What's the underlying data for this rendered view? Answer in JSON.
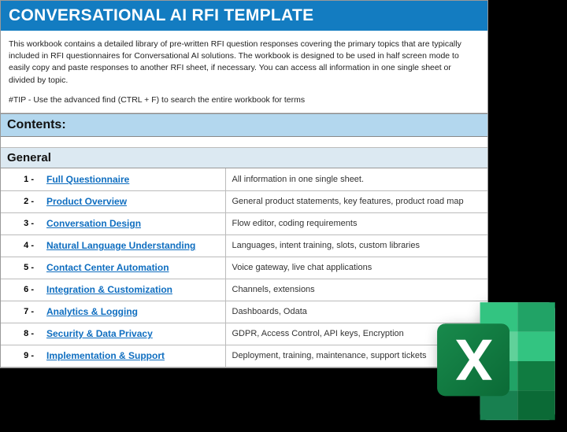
{
  "title": "CONVERSATIONAL AI RFI TEMPLATE",
  "intro": {
    "body": "This workbook contains a detailed library of pre-written RFI question responses covering the primary topics that are typically included in RFI questionnaires for Conversational AI solutions. The workbook is designed to be used in half screen mode to easily copy and paste responses to another RFI sheet, if necessary. You can access all information in one single sheet or divided by topic.",
    "tip": "#TIP - Use the advanced find (CTRL + F) to search the entire workbook for terms"
  },
  "contents_label": "Contents:",
  "section_label": "General",
  "rows": [
    {
      "num": "1 -",
      "link": "Full Questionnaire",
      "desc": "All information in one single sheet."
    },
    {
      "num": "2 -",
      "link": "Product Overview",
      "desc": "General product statements, key features, product road map"
    },
    {
      "num": "3 -",
      "link": "Conversation Design",
      "desc": "Flow editor, coding requirements"
    },
    {
      "num": "4 -",
      "link": "Natural Language Understanding",
      "desc": "Languages, intent training, slots, custom libraries"
    },
    {
      "num": "5 -",
      "link": "Contact Center Automation",
      "desc": "Voice gateway, live chat applications"
    },
    {
      "num": "6 -",
      "link": "Integration & Customization",
      "desc": "Channels, extensions"
    },
    {
      "num": "7 -",
      "link": "Analytics & Logging",
      "desc": "Dashboards, Odata"
    },
    {
      "num": "8 -",
      "link": "Security & Data Privacy",
      "desc": "GDPR, Access Control, API keys, Encryption"
    },
    {
      "num": "9 -",
      "link": "Implementation & Support",
      "desc": "Deployment, training, maintenance, support tickets"
    }
  ]
}
